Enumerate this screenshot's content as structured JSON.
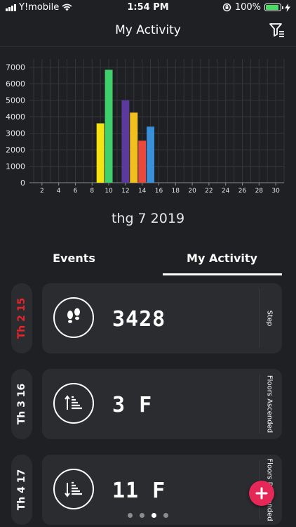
{
  "status": {
    "carrier": "Y!mobile",
    "time": "1:54 PM",
    "battery_pct": "100%",
    "battery_color": "#4cd964"
  },
  "header": {
    "title": "My Activity",
    "filter_icon": "filter-icon"
  },
  "chart_data": {
    "type": "bar",
    "x": [
      9,
      10,
      11,
      12,
      13,
      14,
      15
    ],
    "values": [
      3600,
      6850,
      0,
      5000,
      4250,
      2550,
      3400
    ],
    "colors": [
      "#f5e313",
      "#3fcf6b",
      "",
      "#5a3a9c",
      "#f2c01e",
      "#e8493c",
      "#3a8fd9"
    ],
    "xticks": [
      2,
      4,
      6,
      8,
      10,
      12,
      14,
      16,
      18,
      20,
      22,
      24,
      26,
      28,
      30
    ],
    "yticks": [
      0,
      1000,
      2000,
      3000,
      4000,
      5000,
      6000,
      7000
    ],
    "xlim": [
      0.5,
      31
    ],
    "ylim": [
      0,
      7500
    ],
    "grid": true
  },
  "month_label": "thg 7 2019",
  "tabs": [
    {
      "label": "Events",
      "active": false
    },
    {
      "label": "My Activity",
      "active": true
    }
  ],
  "rows": [
    {
      "date": "Th 2 15",
      "date_color": "#e8252c",
      "value": "3428",
      "label": "Step",
      "icon": "footprints-icon"
    },
    {
      "date": "Th 3 16",
      "date_color": "#ffffff",
      "value": "3 F",
      "label": "Floors Ascended",
      "icon": "floors-ascended-icon"
    },
    {
      "date": "Th 4 17",
      "date_color": "#ffffff",
      "value": "11 F",
      "label": "Floors Descended",
      "icon": "floors-descended-icon"
    }
  ],
  "pagination": {
    "count": 4,
    "active_index": 2
  },
  "fab_icon": "plus-icon"
}
